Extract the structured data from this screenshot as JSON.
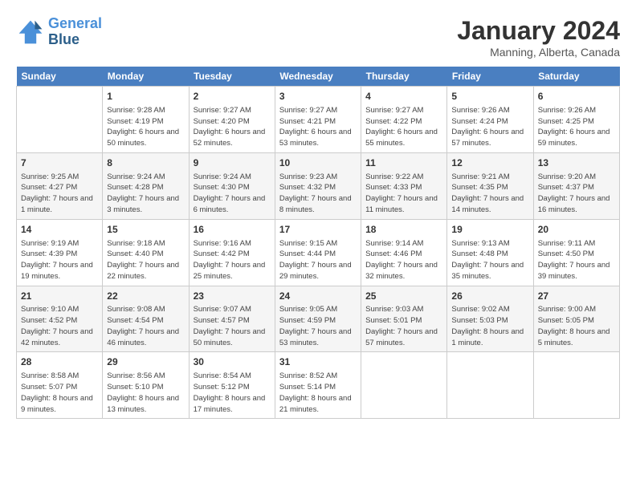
{
  "header": {
    "logo_line1": "General",
    "logo_line2": "Blue",
    "month": "January 2024",
    "location": "Manning, Alberta, Canada"
  },
  "days_of_week": [
    "Sunday",
    "Monday",
    "Tuesday",
    "Wednesday",
    "Thursday",
    "Friday",
    "Saturday"
  ],
  "weeks": [
    [
      {
        "num": "",
        "sunrise": "",
        "sunset": "",
        "daylight": "",
        "empty": true
      },
      {
        "num": "1",
        "sunrise": "Sunrise: 9:28 AM",
        "sunset": "Sunset: 4:19 PM",
        "daylight": "Daylight: 6 hours and 50 minutes."
      },
      {
        "num": "2",
        "sunrise": "Sunrise: 9:27 AM",
        "sunset": "Sunset: 4:20 PM",
        "daylight": "Daylight: 6 hours and 52 minutes."
      },
      {
        "num": "3",
        "sunrise": "Sunrise: 9:27 AM",
        "sunset": "Sunset: 4:21 PM",
        "daylight": "Daylight: 6 hours and 53 minutes."
      },
      {
        "num": "4",
        "sunrise": "Sunrise: 9:27 AM",
        "sunset": "Sunset: 4:22 PM",
        "daylight": "Daylight: 6 hours and 55 minutes."
      },
      {
        "num": "5",
        "sunrise": "Sunrise: 9:26 AM",
        "sunset": "Sunset: 4:24 PM",
        "daylight": "Daylight: 6 hours and 57 minutes."
      },
      {
        "num": "6",
        "sunrise": "Sunrise: 9:26 AM",
        "sunset": "Sunset: 4:25 PM",
        "daylight": "Daylight: 6 hours and 59 minutes."
      }
    ],
    [
      {
        "num": "7",
        "sunrise": "Sunrise: 9:25 AM",
        "sunset": "Sunset: 4:27 PM",
        "daylight": "Daylight: 7 hours and 1 minute."
      },
      {
        "num": "8",
        "sunrise": "Sunrise: 9:24 AM",
        "sunset": "Sunset: 4:28 PM",
        "daylight": "Daylight: 7 hours and 3 minutes."
      },
      {
        "num": "9",
        "sunrise": "Sunrise: 9:24 AM",
        "sunset": "Sunset: 4:30 PM",
        "daylight": "Daylight: 7 hours and 6 minutes."
      },
      {
        "num": "10",
        "sunrise": "Sunrise: 9:23 AM",
        "sunset": "Sunset: 4:32 PM",
        "daylight": "Daylight: 7 hours and 8 minutes."
      },
      {
        "num": "11",
        "sunrise": "Sunrise: 9:22 AM",
        "sunset": "Sunset: 4:33 PM",
        "daylight": "Daylight: 7 hours and 11 minutes."
      },
      {
        "num": "12",
        "sunrise": "Sunrise: 9:21 AM",
        "sunset": "Sunset: 4:35 PM",
        "daylight": "Daylight: 7 hours and 14 minutes."
      },
      {
        "num": "13",
        "sunrise": "Sunrise: 9:20 AM",
        "sunset": "Sunset: 4:37 PM",
        "daylight": "Daylight: 7 hours and 16 minutes."
      }
    ],
    [
      {
        "num": "14",
        "sunrise": "Sunrise: 9:19 AM",
        "sunset": "Sunset: 4:39 PM",
        "daylight": "Daylight: 7 hours and 19 minutes."
      },
      {
        "num": "15",
        "sunrise": "Sunrise: 9:18 AM",
        "sunset": "Sunset: 4:40 PM",
        "daylight": "Daylight: 7 hours and 22 minutes."
      },
      {
        "num": "16",
        "sunrise": "Sunrise: 9:16 AM",
        "sunset": "Sunset: 4:42 PM",
        "daylight": "Daylight: 7 hours and 25 minutes."
      },
      {
        "num": "17",
        "sunrise": "Sunrise: 9:15 AM",
        "sunset": "Sunset: 4:44 PM",
        "daylight": "Daylight: 7 hours and 29 minutes."
      },
      {
        "num": "18",
        "sunrise": "Sunrise: 9:14 AM",
        "sunset": "Sunset: 4:46 PM",
        "daylight": "Daylight: 7 hours and 32 minutes."
      },
      {
        "num": "19",
        "sunrise": "Sunrise: 9:13 AM",
        "sunset": "Sunset: 4:48 PM",
        "daylight": "Daylight: 7 hours and 35 minutes."
      },
      {
        "num": "20",
        "sunrise": "Sunrise: 9:11 AM",
        "sunset": "Sunset: 4:50 PM",
        "daylight": "Daylight: 7 hours and 39 minutes."
      }
    ],
    [
      {
        "num": "21",
        "sunrise": "Sunrise: 9:10 AM",
        "sunset": "Sunset: 4:52 PM",
        "daylight": "Daylight: 7 hours and 42 minutes."
      },
      {
        "num": "22",
        "sunrise": "Sunrise: 9:08 AM",
        "sunset": "Sunset: 4:54 PM",
        "daylight": "Daylight: 7 hours and 46 minutes."
      },
      {
        "num": "23",
        "sunrise": "Sunrise: 9:07 AM",
        "sunset": "Sunset: 4:57 PM",
        "daylight": "Daylight: 7 hours and 50 minutes."
      },
      {
        "num": "24",
        "sunrise": "Sunrise: 9:05 AM",
        "sunset": "Sunset: 4:59 PM",
        "daylight": "Daylight: 7 hours and 53 minutes."
      },
      {
        "num": "25",
        "sunrise": "Sunrise: 9:03 AM",
        "sunset": "Sunset: 5:01 PM",
        "daylight": "Daylight: 7 hours and 57 minutes."
      },
      {
        "num": "26",
        "sunrise": "Sunrise: 9:02 AM",
        "sunset": "Sunset: 5:03 PM",
        "daylight": "Daylight: 8 hours and 1 minute."
      },
      {
        "num": "27",
        "sunrise": "Sunrise: 9:00 AM",
        "sunset": "Sunset: 5:05 PM",
        "daylight": "Daylight: 8 hours and 5 minutes."
      }
    ],
    [
      {
        "num": "28",
        "sunrise": "Sunrise: 8:58 AM",
        "sunset": "Sunset: 5:07 PM",
        "daylight": "Daylight: 8 hours and 9 minutes."
      },
      {
        "num": "29",
        "sunrise": "Sunrise: 8:56 AM",
        "sunset": "Sunset: 5:10 PM",
        "daylight": "Daylight: 8 hours and 13 minutes."
      },
      {
        "num": "30",
        "sunrise": "Sunrise: 8:54 AM",
        "sunset": "Sunset: 5:12 PM",
        "daylight": "Daylight: 8 hours and 17 minutes."
      },
      {
        "num": "31",
        "sunrise": "Sunrise: 8:52 AM",
        "sunset": "Sunset: 5:14 PM",
        "daylight": "Daylight: 8 hours and 21 minutes."
      },
      {
        "num": "",
        "sunrise": "",
        "sunset": "",
        "daylight": "",
        "empty": true
      },
      {
        "num": "",
        "sunrise": "",
        "sunset": "",
        "daylight": "",
        "empty": true
      },
      {
        "num": "",
        "sunrise": "",
        "sunset": "",
        "daylight": "",
        "empty": true
      }
    ]
  ]
}
